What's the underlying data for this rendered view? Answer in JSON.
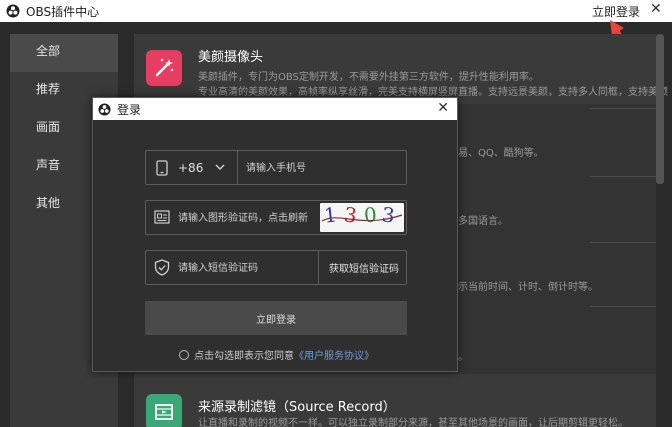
{
  "window": {
    "title": "OBS插件中心",
    "login_link": "立即登录",
    "close_glyph": "✕"
  },
  "sidebar": {
    "items": [
      {
        "label": "全部"
      },
      {
        "label": "推荐"
      },
      {
        "label": "画面"
      },
      {
        "label": "声音"
      },
      {
        "label": "其他"
      }
    ]
  },
  "main": {
    "card1": {
      "title": "美颜摄像头",
      "desc1": "美颜插件，专门为OBS定制开发，不需要外挂第三方软件，提升性能利用率。",
      "desc2": "专业高清的美颜效果，高帧率纵享丝滑，完美支持横屏竖屏直播。支持远景美颜，支持多人同框，支持美颜"
    },
    "fragments": {
      "f1": "易、QQ、酷狗等。",
      "f2": "多国语言。",
      "f3": "示当前时间、计时、倒计时等。",
      "f4": "。"
    },
    "card_bottom": {
      "title": "来源录制滤镜（Source Record）",
      "desc": "让直播和录制的视频不一样。可以独立录制部分来源，甚至其他场景的画面，让后期剪辑更轻松。"
    }
  },
  "dialog": {
    "title": "登录",
    "close_glyph": "✕",
    "phone": {
      "country_code": "+86",
      "placeholder": "请输入手机号"
    },
    "captcha": {
      "placeholder": "请输入图形验证码，点击刷新",
      "chars": [
        "1",
        "3",
        "0",
        "3"
      ]
    },
    "sms": {
      "placeholder": "请输入短信验证码",
      "button_label": "获取短信验证码"
    },
    "submit_label": "立即登录",
    "agree_text": "点击勾选即表示您同意",
    "agree_link": "《用户服务协议》"
  },
  "colors": {
    "accent_red": "#e73d63",
    "accent_green": "#3aa876",
    "link_blue": "#6a9ddc",
    "arrow_red": "#e8453c"
  }
}
